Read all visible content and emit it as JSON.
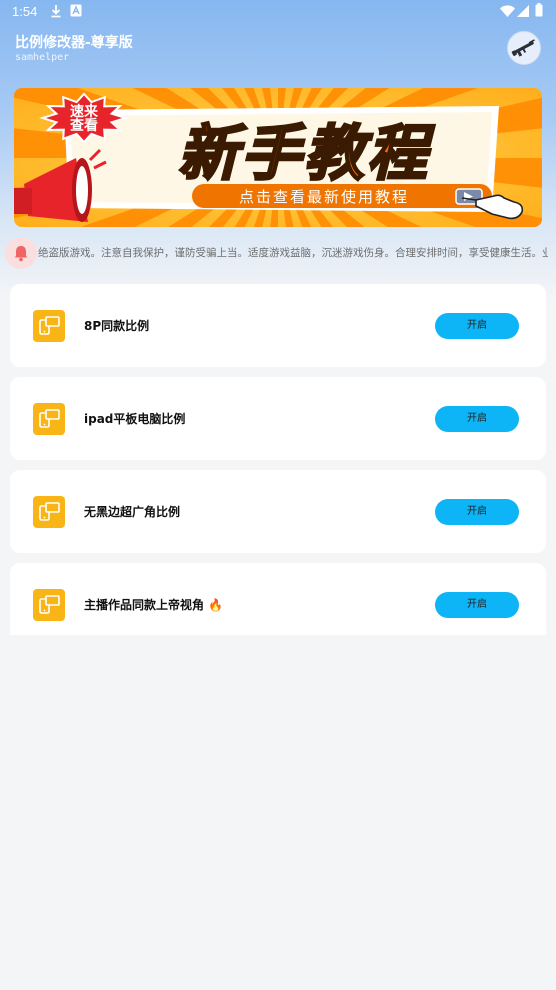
{
  "status_bar": {
    "time": "1:54",
    "icons": [
      "download-icon",
      "app-a-icon",
      "wifi-icon",
      "signal-icon",
      "battery-icon"
    ]
  },
  "header": {
    "title": "比例修改器-尊享版",
    "subtitle": "samhelper",
    "avatar_icon": "rifle-icon"
  },
  "banner": {
    "badge_line1": "速来",
    "badge_line2": "查看",
    "headline": "新手教程",
    "cta": "点击查看最新使用教程",
    "colors": {
      "orange": "#ff8a00",
      "yellow": "#ffc21a",
      "red": "#e8242b"
    }
  },
  "notice": {
    "icon": "bell-icon",
    "text": "绝盗版游戏。注意自我保护，谨防受骗上当。适度游戏益脑，沉迷游戏伤身。合理安排时间，享受健康生活。业精于"
  },
  "options": [
    {
      "label": "8P同款比例",
      "button": "开启",
      "icon": "devices-icon"
    },
    {
      "label": "ipad平板电脑比例",
      "button": "开启",
      "icon": "devices-icon"
    },
    {
      "label": "无黑边超广角比例",
      "button": "开启",
      "icon": "devices-icon"
    },
    {
      "label": "主播作品同款上帝视角",
      "button": "开启",
      "icon": "devices-icon",
      "badge": "🔥"
    }
  ],
  "colors": {
    "accent": "#0db4f6",
    "icon_bg": "#f9b516"
  }
}
